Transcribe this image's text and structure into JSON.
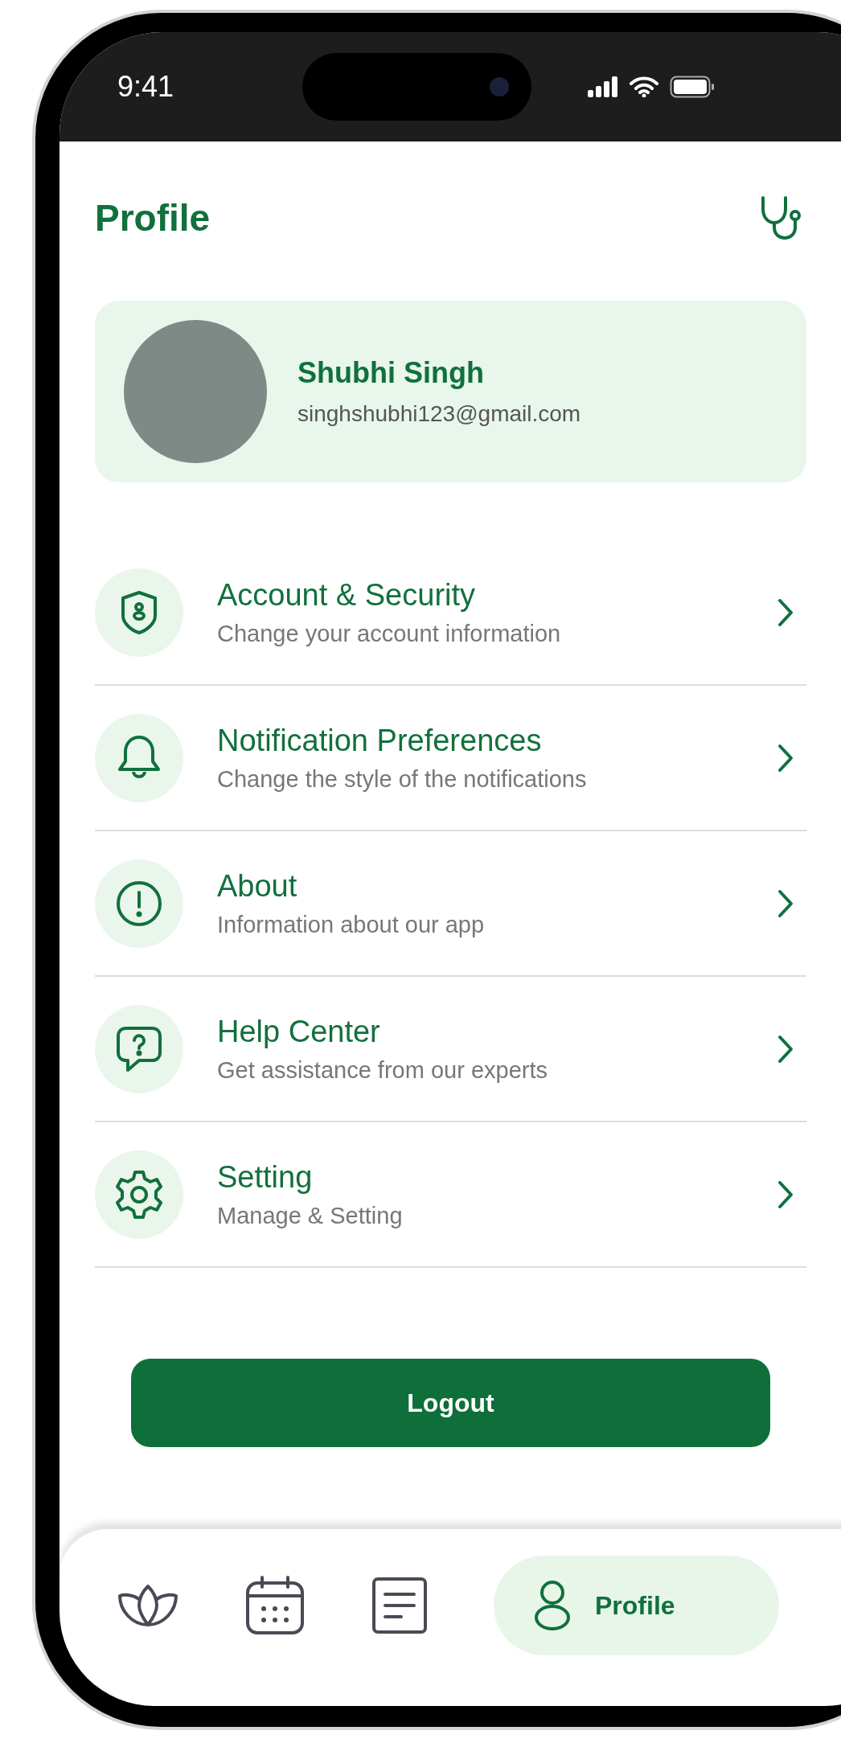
{
  "status_bar": {
    "time": "9:41"
  },
  "header": {
    "title": "Profile"
  },
  "profile": {
    "name": "Shubhi Singh",
    "email": "singhshubhi123@gmail.com"
  },
  "menu": [
    {
      "title": "Account & Security",
      "subtitle": "Change your account information"
    },
    {
      "title": "Notification Preferences",
      "subtitle": "Change the style of the notifications"
    },
    {
      "title": "About",
      "subtitle": "Information about our app"
    },
    {
      "title": "Help Center",
      "subtitle": "Get assistance from our experts"
    },
    {
      "title": "Setting",
      "subtitle": "Manage & Setting"
    }
  ],
  "logout_button": "Logout",
  "bottom_nav": [
    {
      "selected": false
    },
    {
      "selected": false
    },
    {
      "selected": false
    },
    {
      "label": "Profile",
      "selected": true
    }
  ]
}
